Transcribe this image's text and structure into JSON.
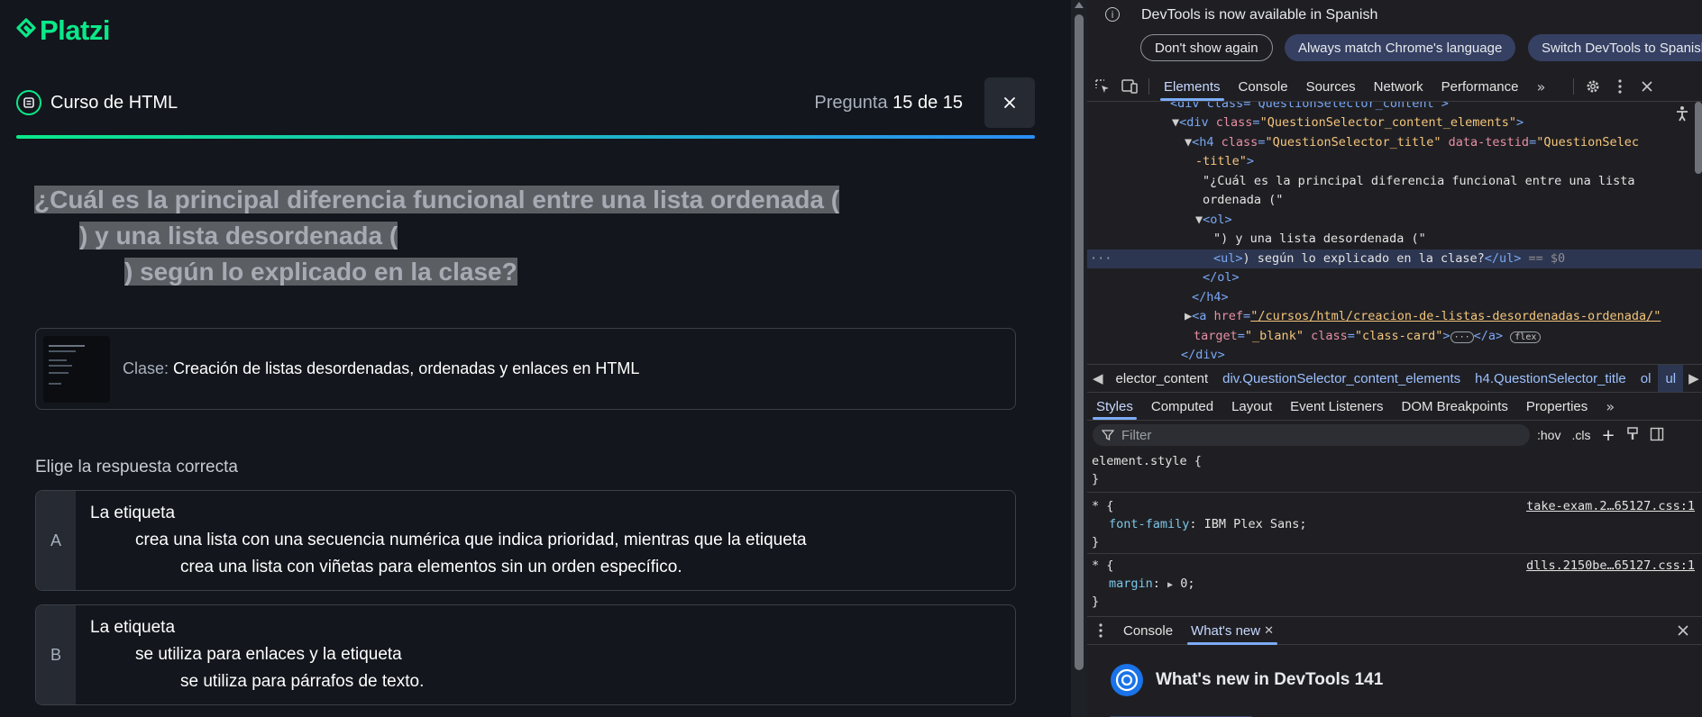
{
  "page": {
    "logo_text": "Platzi",
    "course_title": "Curso de HTML",
    "progress_label": "Pregunta",
    "progress_value": "15 de 15",
    "progress_fraction": 1.0,
    "question_lines": [
      "¿Cuál es la principal diferencia funcional entre una lista ordenada (",
      ") y una lista desordenada (",
      ") según lo explicado en la clase?"
    ],
    "class_label": "Clase:",
    "class_name": "Creación de listas desordenadas, ordenadas y enlaces en HTML",
    "choose_label": "Elige la respuesta correcta",
    "options": [
      {
        "letter": "A",
        "lines": [
          "La etiqueta",
          "crea una lista con una secuencia numérica que indica prioridad, mientras que la etiqueta",
          "crea una lista con viñetas para elementos sin un orden específico."
        ]
      },
      {
        "letter": "B",
        "lines": [
          "La etiqueta",
          "se utiliza para enlaces y la etiqueta",
          "se utiliza para párrafos de texto."
        ]
      }
    ]
  },
  "devtools": {
    "info_message": "DevTools is now available in Spanish",
    "info_buttons": [
      "Don't show again",
      "Always match Chrome's language",
      "Switch DevTools to Spanish"
    ],
    "main_tabs": [
      "Elements",
      "Console",
      "Sources",
      "Network",
      "Performance"
    ],
    "active_tab": "Elements",
    "dom": {
      "r1_tag": "<div class=\"QuestionSelector_content\">",
      "r2_open": "<div ",
      "r2_attr": "class",
      "r2_val": "\"QuestionSelector_content_elements\"",
      "r3_open": "<h4 ",
      "r3_attr1": "class",
      "r3_val1": "\"QuestionSelector_title\"",
      "r3_attr2": "data-testid",
      "r3_val2": "\"QuestionSelec",
      "r4_val": "-title\"",
      "r5_text": "\"¿Cuál es la principal diferencia funcional entre una lista",
      "r6_text": "ordenada (\"",
      "r7_tag": "<ol>",
      "r8_text": "\") y una lista desordenada (\"",
      "r9_tag": "<ul>",
      "r9_text": ") según lo explicado en la clase?",
      "r9_close": "</ul>",
      "r9_eq": "== $0",
      "r10_tag": "</ol>",
      "r11_tag": "</h4>",
      "r12_open": "<a ",
      "r12_attr": "href",
      "r12_val": "\"/cursos/html/creacion-de-listas-desordenadas-ordenada/\"",
      "r13_attr1": "target",
      "r13_val1": "\"_blank\"",
      "r13_attr2": "class",
      "r13_val2": "\"class-card\"",
      "r13_close": "</a>",
      "r13_badge": "flex",
      "r14_tag": "</div>"
    },
    "breadcrumbs": [
      "elector_content",
      "div.QuestionSelector_content_elements",
      "h4.QuestionSelector_title",
      "ol",
      "ul"
    ],
    "sub_tabs": [
      "Styles",
      "Computed",
      "Layout",
      "Event Listeners",
      "DOM Breakpoints",
      "Properties"
    ],
    "filter_placeholder": "Filter",
    "hov": ":hov",
    "cls": ".cls",
    "styles": {
      "r1_sel": "element.style {",
      "r1_close": "}",
      "r2_sel": "* {",
      "r2_prop": "font-family",
      "r2_val": "IBM Plex Sans;",
      "r2_src": "take-exam.2…65127.css:1",
      "r2_close": "}",
      "r3_sel": "* {",
      "r3_prop": "margin",
      "r3_val": "0;",
      "r3_src": "dlls.2150be…65127.css:1",
      "r3_close": "}"
    },
    "drawer_tabs": [
      "Console",
      "What's new"
    ],
    "whatsnew_title": "What's new in DevTools 141"
  },
  "colors": {
    "brand_green": "#0ae98a",
    "devtools_accent": "#7cacf8"
  }
}
